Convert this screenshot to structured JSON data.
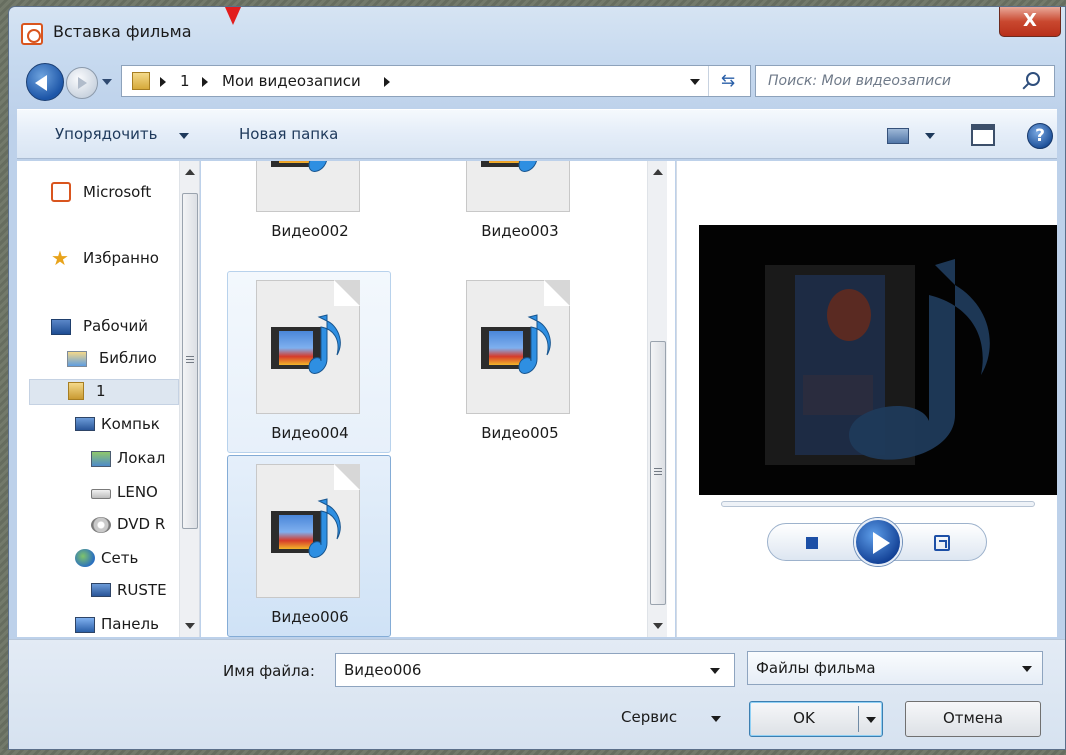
{
  "window": {
    "title": "Вставка фильма",
    "close_label": "X"
  },
  "address": {
    "crumbs": [
      "1",
      "Мои видеозаписи"
    ],
    "search_placeholder": "Поиск: Мои видеозаписи"
  },
  "toolbar": {
    "organize_label": "Упорядочить",
    "new_folder_label": "Новая папка",
    "help_label": "?"
  },
  "sidebar": {
    "items": [
      {
        "label": "Microsoft",
        "icon": "app-icon"
      },
      {
        "label": "Избранно",
        "icon": "star-icon"
      },
      {
        "label": "Рабочий",
        "icon": "desktop-icon"
      },
      {
        "label": "Библио",
        "icon": "library-icon"
      },
      {
        "label": "1",
        "icon": "user-folder-icon",
        "selected": true
      },
      {
        "label": "Компьк",
        "icon": "computer-icon"
      },
      {
        "label": "Локал",
        "icon": "local-disk-icon"
      },
      {
        "label": "LENO",
        "icon": "drive-icon"
      },
      {
        "label": "DVD R",
        "icon": "dvd-icon"
      },
      {
        "label": "Сеть",
        "icon": "network-icon"
      },
      {
        "label": "RUSTE",
        "icon": "network-computer-icon"
      },
      {
        "label": "Панель",
        "icon": "control-panel-icon"
      }
    ]
  },
  "files": [
    {
      "name": "Видео002"
    },
    {
      "name": "Видео003"
    },
    {
      "name": "Видео004"
    },
    {
      "name": "Видео005"
    },
    {
      "name": "Видео006"
    }
  ],
  "footer": {
    "filename_label": "Имя файла:",
    "filename_value": "Видео006",
    "filetype_value": "Файлы фильма",
    "service_label": "Сервис",
    "ok_label": "OK",
    "cancel_label": "Отмена"
  }
}
